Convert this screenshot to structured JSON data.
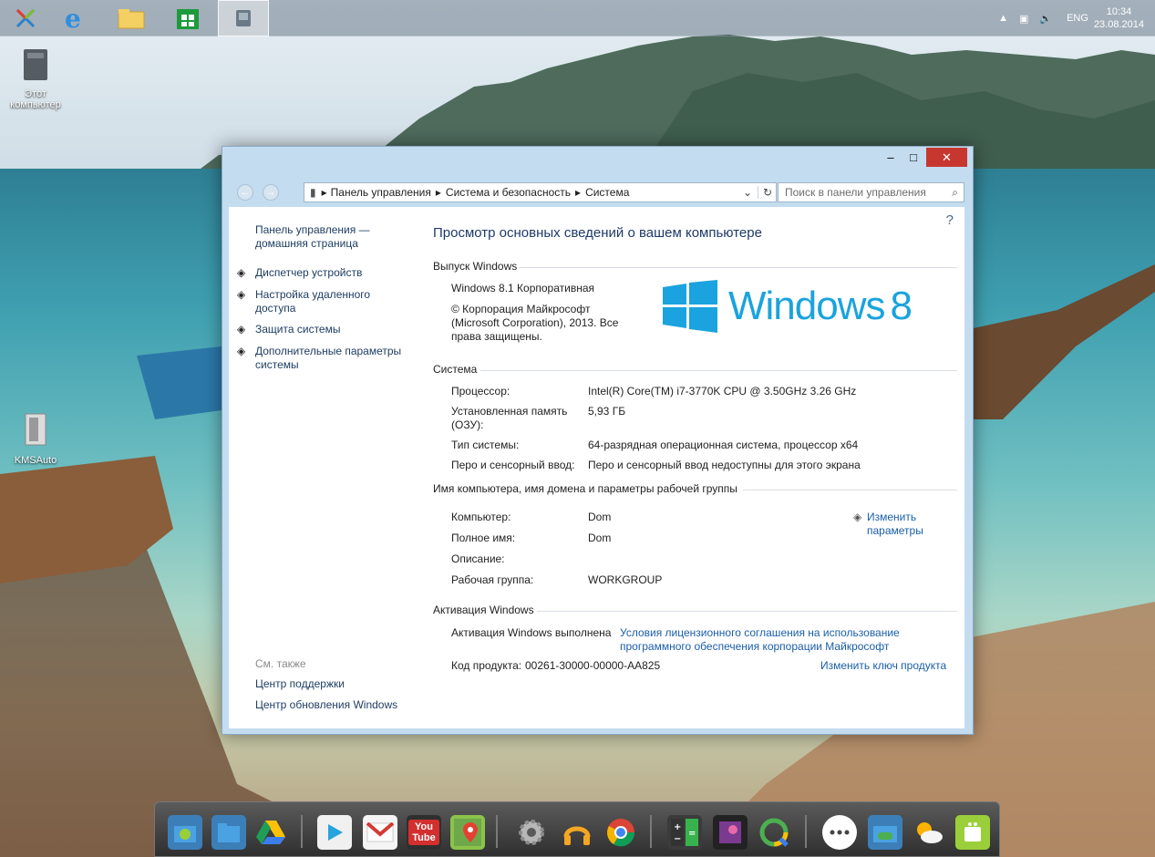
{
  "taskbar": {
    "tray_lang": "ENG",
    "clock_time": "10:34",
    "clock_date": "23.08.2014"
  },
  "desktop": {
    "icons": [
      {
        "label": "Этот компьютер"
      },
      {
        "label": "KMSAuto"
      }
    ]
  },
  "window": {
    "controls": {
      "minimize": "–",
      "maximize": "□",
      "close": "✕"
    },
    "nav": {
      "back": "←",
      "forward": "→"
    },
    "breadcrumb": [
      "Панель управления",
      "Система и безопасность",
      "Система"
    ],
    "search_placeholder": "Поиск в панели управления",
    "help": "?",
    "sidebar": {
      "home": "Панель управления — домашняя страница",
      "items": [
        "Диспетчер устройств",
        "Настройка удаленного доступа",
        "Защита системы",
        "Дополнительные параметры системы"
      ],
      "see_also": "См. также",
      "see_also_items": [
        "Центр поддержки",
        "Центр обновления Windows"
      ]
    },
    "main": {
      "title": "Просмотр основных сведений о вашем компьютере",
      "edition": {
        "header": "Выпуск Windows",
        "name": "Windows 8.1 Корпоративная",
        "copyright": "© Корпорация Майкрософт (Microsoft Corporation), 2013. Все права защищены.",
        "logo_text": "Windows",
        "logo_number": "8"
      },
      "system": {
        "header": "Система",
        "rows": [
          {
            "label": "Процессор:",
            "value": "Intel(R) Core(TM) i7-3770K CPU @ 3.50GHz   3.26 GHz"
          },
          {
            "label": "Установленная память (ОЗУ):",
            "value": "5,93 ГБ"
          },
          {
            "label": "Тип системы:",
            "value": "64-разрядная операционная система, процессор x64"
          },
          {
            "label": "Перо и сенсорный ввод:",
            "value": "Перо и сенсорный ввод недоступны для этого экрана"
          }
        ]
      },
      "computer": {
        "header": "Имя компьютера, имя домена и параметры рабочей группы",
        "change_link": "Изменить параметры",
        "rows": [
          {
            "label": "Компьютер:",
            "value": "Dom"
          },
          {
            "label": "Полное имя:",
            "value": "Dom"
          },
          {
            "label": "Описание:",
            "value": ""
          },
          {
            "label": "Рабочая группа:",
            "value": "WORKGROUP"
          }
        ]
      },
      "activation": {
        "header": "Активация Windows",
        "status": "Активация Windows выполнена",
        "license_link": "Условия лицензионного соглашения на использование программного обеспечения корпорации Майкрософт",
        "product_key_label": "Код продукта:",
        "product_key": "00261-30000-00000-AA825",
        "change_key_link": "Изменить ключ продукта"
      }
    }
  },
  "dock": {
    "youtube_label": "You Tube"
  },
  "colors": {
    "link": "#1a5fa8",
    "title": "#1e3a6a",
    "close": "#c7372f",
    "windows_logo": "#1aa3de"
  }
}
